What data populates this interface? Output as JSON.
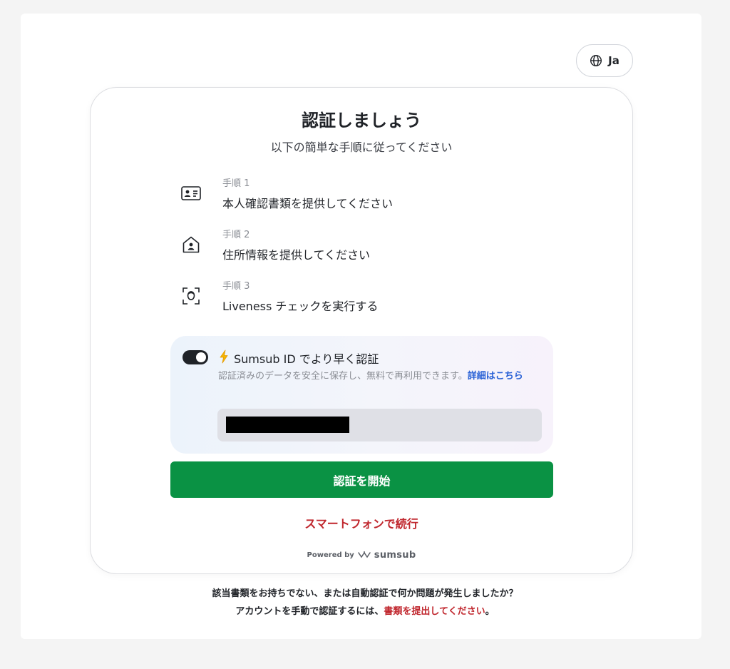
{
  "language_button": {
    "label": "Ja",
    "icon": "globe-icon"
  },
  "card": {
    "title": "認証しましょう",
    "subtitle": "以下の簡単な手順に従ってください",
    "steps": [
      {
        "number": "手順 1",
        "label": "本人確認書類を提供してください",
        "icon": "id-card-icon"
      },
      {
        "number": "手順 2",
        "label": "住所情報を提供してください",
        "icon": "home-person-icon"
      },
      {
        "number": "手順 3",
        "label": "Liveness チェックを実行する",
        "icon": "face-scan-icon"
      }
    ],
    "sumsub_id": {
      "toggle_on": true,
      "title": "Sumsub ID でより早く認証",
      "description": "認証済みのデータを安全に保存し、無料で再利用できます。",
      "link": "詳細はこちら",
      "input_value_redacted": true
    },
    "start_button": "認証を開始",
    "phone_link": "スマートフォンで続行",
    "powered_by": {
      "label": "Powered by",
      "brand": "sumsub"
    }
  },
  "footer": {
    "line1": "該当書類をお持ちでない、または自動認証で何か問題が発生しましたか？",
    "line2_prefix": "アカウントを手動で認証するには、",
    "line2_link": "書類を提出してください",
    "line2_suffix": "。"
  },
  "colors": {
    "primary_button": "#0a9244",
    "link_red": "#c0262d",
    "link_blue": "#2a62d6",
    "toggle": "#1f2227"
  }
}
